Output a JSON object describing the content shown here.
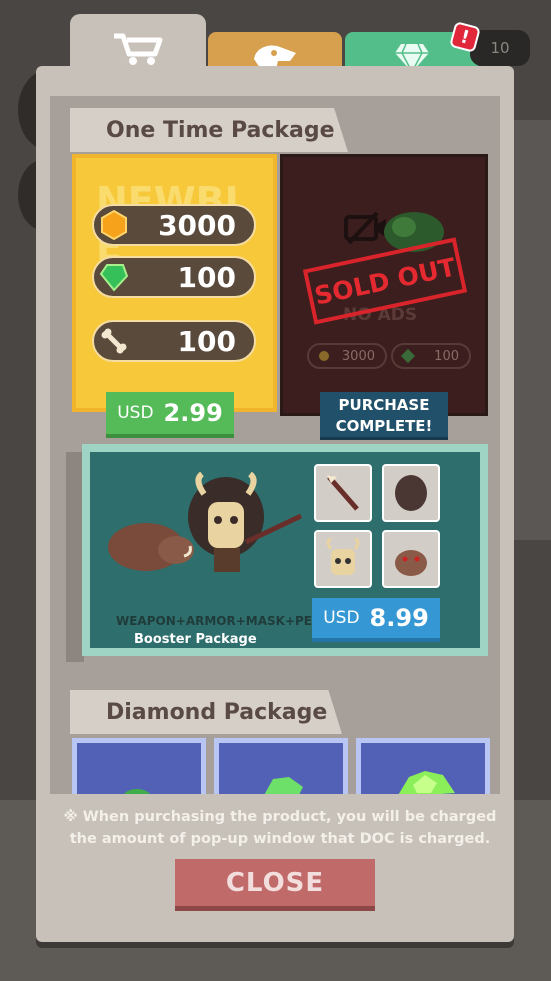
{
  "tabs": [
    {
      "icon": "shopping-cart-icon",
      "active": true
    },
    {
      "icon": "dinosaur-skull-icon",
      "active": false
    },
    {
      "icon": "diamond-icon",
      "active": false
    }
  ],
  "top_counter": "10",
  "alert_badge": "!",
  "one_time": {
    "title": "One Time Package",
    "newbie": {
      "watermark": "NEWBI E",
      "items": [
        {
          "icon": "coin-icon",
          "value": "3000"
        },
        {
          "icon": "gem-icon",
          "value": "100"
        },
        {
          "icon": "bone-icon",
          "value": "100"
        }
      ],
      "price": {
        "currency": "USD",
        "amount": "2.99"
      }
    },
    "no_ads": {
      "stamp": "SOLD OUT",
      "label": "NO ADS",
      "items": [
        {
          "icon": "coin-icon",
          "value": "3000"
        },
        {
          "icon": "gem-icon",
          "value": "100"
        }
      ],
      "button": [
        "PURCHASE",
        "COMPLETE!"
      ]
    }
  },
  "booster": {
    "tagline": "WEAPON+ARMOR+MASK+PET",
    "name": "Booster Package",
    "items": [
      "spear-icon",
      "fur-armor-icon",
      "mask-icon",
      "boar-pet-icon"
    ],
    "price": {
      "currency": "USD",
      "amount": "8.99"
    }
  },
  "diamond": {
    "title": "Diamond Package",
    "cards": [
      "diamond-small-icon",
      "diamond-medium-icon",
      "diamond-large-icon"
    ]
  },
  "note": "※ When purchasing the product, you will be charged the amount of pop-up window that DOC is charged.",
  "close_label": "CLOSE"
}
